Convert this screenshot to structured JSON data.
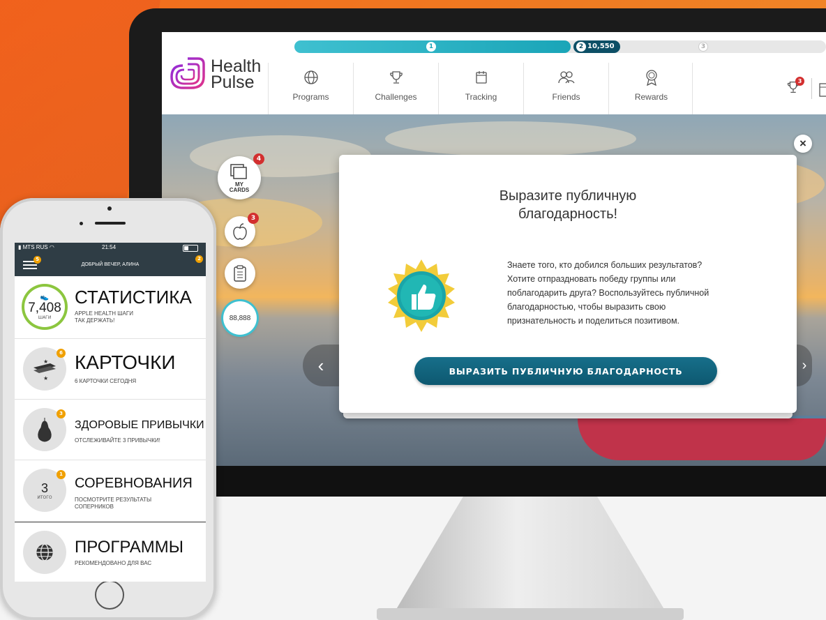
{
  "app": {
    "brand_line1": "Health",
    "brand_line2": "Pulse"
  },
  "progress": {
    "level1": "1",
    "level2": "2",
    "level2_points": "10,550",
    "level3": "3",
    "fill_fraction": 0.52
  },
  "nav": [
    {
      "label": "Programs",
      "icon": "globe-icon"
    },
    {
      "label": "Challenges",
      "icon": "trophy-icon"
    },
    {
      "label": "Tracking",
      "icon": "calendar-icon"
    },
    {
      "label": "Friends",
      "icon": "friends-icon"
    },
    {
      "label": "Rewards",
      "icon": "award-icon"
    }
  ],
  "header": {
    "trophy_badge": "3"
  },
  "tools": {
    "cards_label_1": "MY",
    "cards_label_2": "CARDS",
    "cards_badge": "4",
    "habits_badge": "3",
    "steps_value": "88,888"
  },
  "modal": {
    "title_line1": "Выразите публичную",
    "title_line2": "благодарность!",
    "body_lines": [
      "Знаете того, кто добился больших результатов?",
      "Хотите отпраздновать победу группы или",
      "поблагодарить друга? Воспользуйтесь публичной",
      "благодарностью, чтобы выразить свою",
      "признательность и поделиться позитивом."
    ],
    "cta_label": "ВЫРАЗИТЬ ПУБЛИЧНУЮ БЛАГОДАРНОСТЬ",
    "close_label": "×",
    "prev_label": "‹",
    "next_label": "›"
  },
  "phone": {
    "carrier": "MTS RUS",
    "time": "21:54",
    "menu_badge": "5",
    "right_badge": "2",
    "greeting": "ДОБРЫЙ ВЕЧЕР, АЛИНА",
    "rows": [
      {
        "title": "СТАТИСТИКА",
        "value": "7,408",
        "value_label": "ШАГИ",
        "sub1": "APPLE HEALTH ШАГИ",
        "sub2": "ТАК ДЕРЖАТЬ!"
      },
      {
        "title": "КАРТОЧКИ",
        "badge": "6",
        "sub1": "6 КАРТОЧКИ СЕГОДНЯ"
      },
      {
        "title": "ЗДОРОВЫЕ ПРИВЫЧКИ",
        "badge": "3",
        "sub1": "ОТСЛЕЖИВАЙТЕ 3 ПРИВЫЧКИ!"
      },
      {
        "title": "СОРЕВНОВАНИЯ",
        "badge": "1",
        "value": "3",
        "value_label": "ИТОГО",
        "sub1": "ПОСМОТРИТЕ РЕЗУЛЬТАТЫ",
        "sub2": "СОПЕРНИКОВ"
      },
      {
        "title": "ПРОГРАММЫ",
        "sub1": "РЕКОМЕНДОВАНО ДЛЯ ВАС"
      }
    ]
  },
  "colors": {
    "accent": "#1aa5b8",
    "brand_dark": "#0d5870",
    "orange": "#f26a1b",
    "badge_red": "#d32f2f",
    "badge_orange": "#f0a000"
  }
}
